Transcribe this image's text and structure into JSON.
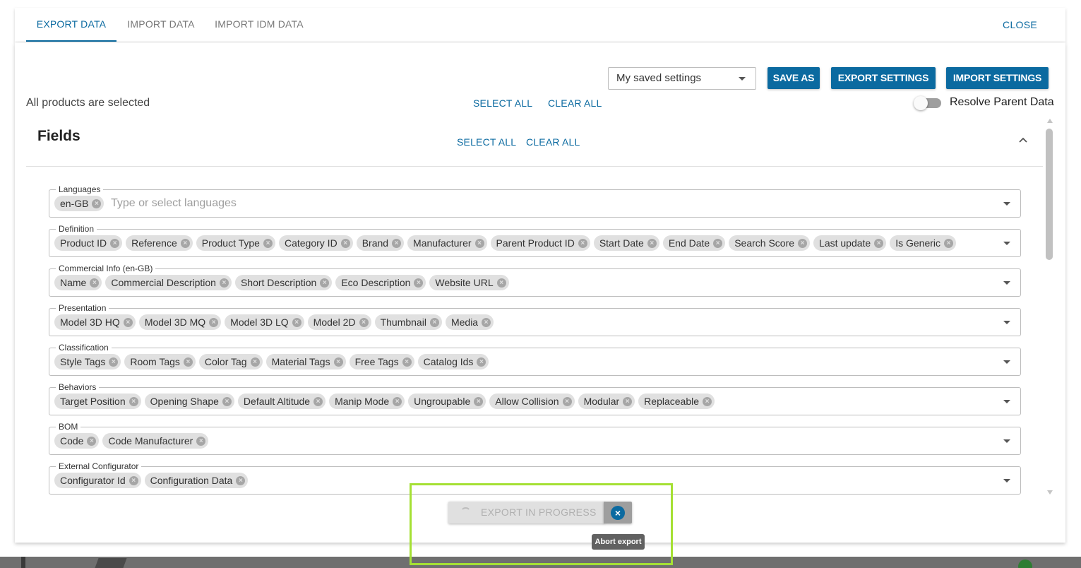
{
  "tabs": [
    {
      "label": "EXPORT DATA",
      "active": true
    },
    {
      "label": "IMPORT DATA",
      "active": false
    },
    {
      "label": "IMPORT IDM DATA",
      "active": false
    }
  ],
  "close_label": "CLOSE",
  "toolbar": {
    "saved_settings_value": "My saved settings",
    "save_as_label": "SAVE AS",
    "export_settings_label": "EXPORT SETTINGS",
    "import_settings_label": "IMPORT SETTINGS"
  },
  "selection": {
    "status_text": "All products are selected",
    "select_all_label": "SELECT ALL",
    "clear_all_label": "CLEAR ALL"
  },
  "resolve_parent": {
    "label": "Resolve Parent Data",
    "enabled": false
  },
  "fields": {
    "title": "Fields",
    "select_all_label": "SELECT ALL",
    "clear_all_label": "CLEAR ALL",
    "groups": [
      {
        "label": "Languages",
        "chips": [
          "en-GB"
        ],
        "placeholder": "Type or select languages"
      },
      {
        "label": "Definition",
        "chips": [
          "Product ID",
          "Reference",
          "Product Type",
          "Category ID",
          "Brand",
          "Manufacturer",
          "Parent Product ID",
          "Start Date",
          "End Date",
          "Search Score",
          "Last update",
          "Is Generic"
        ]
      },
      {
        "label": "Commercial Info (en-GB)",
        "chips": [
          "Name",
          "Commercial Description",
          "Short Description",
          "Eco Description",
          "Website URL"
        ]
      },
      {
        "label": "Presentation",
        "chips": [
          "Model 3D HQ",
          "Model 3D MQ",
          "Model 3D LQ",
          "Model 2D",
          "Thumbnail",
          "Media"
        ]
      },
      {
        "label": "Classification",
        "chips": [
          "Style Tags",
          "Room Tags",
          "Color Tag",
          "Material Tags",
          "Free Tags",
          "Catalog Ids"
        ]
      },
      {
        "label": "Behaviors",
        "chips": [
          "Target Position",
          "Opening Shape",
          "Default Altitude",
          "Manip Mode",
          "Ungroupable",
          "Allow Collision",
          "Modular",
          "Replaceable"
        ]
      },
      {
        "label": "BOM",
        "chips": [
          "Code",
          "Code Manufacturer"
        ]
      },
      {
        "label": "External Configurator",
        "chips": [
          "Configurator Id",
          "Configuration Data"
        ]
      }
    ]
  },
  "export_progress": {
    "label": "EXPORT IN PROGRESS",
    "abort_tooltip": "Abort export"
  },
  "colors": {
    "accent": "#0b6aa0",
    "highlight": "#a5e034",
    "chip_bg": "#e0e0e0"
  }
}
